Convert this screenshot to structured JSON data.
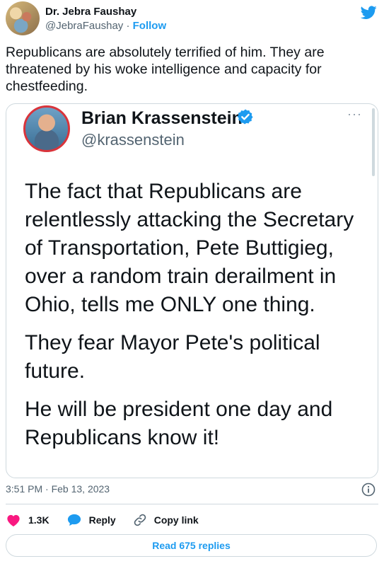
{
  "header": {
    "author_name": "Dr. Jebra Faushay",
    "handle": "@JebraFaushay",
    "separator": "·",
    "follow_label": "Follow"
  },
  "tweet": {
    "text": "Republicans are absolutely terrified of him. They are threatened by his woke intelligence and capacity for chestfeeding."
  },
  "embedded": {
    "name": "Brian Krassenstein",
    "handle": "@krassenstein",
    "more": "···",
    "paragraphs": [
      "The fact that Republicans are relentlessly attacking the Secretary of Transportation, Pete Buttigieg, over a random train derailment in Ohio, tells me ONLY one thing.",
      "They fear Mayor Pete's political future.",
      "He will be president one day and Republicans know it!"
    ]
  },
  "meta": {
    "timestamp": "3:51 PM · Feb 13, 2023"
  },
  "actions": {
    "likes": "1.3K",
    "reply": "Reply",
    "copy_link": "Copy link"
  },
  "read_replies": "Read 675 replies",
  "colors": {
    "brand": "#1d9bf0",
    "heart": "#f91880",
    "text": "#0f1419",
    "muted": "#536471"
  }
}
